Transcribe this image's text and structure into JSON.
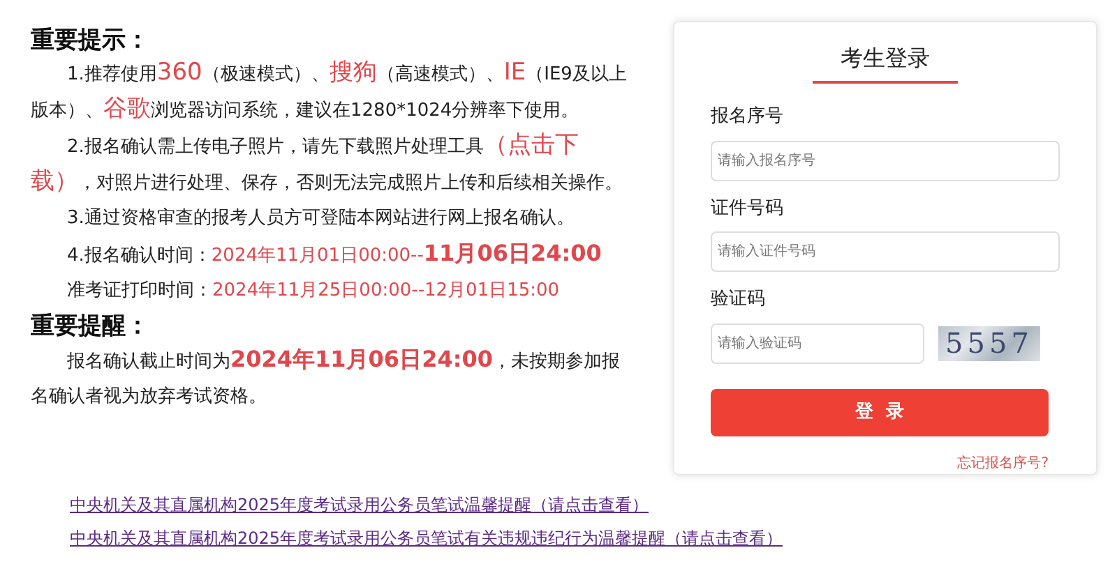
{
  "notice": {
    "heading": "重要提示：",
    "paragraphs": [
      [
        {
          "kind": "plain",
          "text": "1.推荐使用"
        },
        {
          "kind": "red-large",
          "text": "360"
        },
        {
          "kind": "plain",
          "text": "（极速模式）、"
        },
        {
          "kind": "red-large",
          "text": "搜狗"
        },
        {
          "kind": "plain",
          "text": "（高速模式）、"
        },
        {
          "kind": "red-large",
          "text": "IE"
        },
        {
          "kind": "plain",
          "text": "（IE9及以上版本）、"
        },
        {
          "kind": "red-large",
          "text": "谷歌"
        },
        {
          "kind": "plain",
          "text": "浏览器访问系统，建议在1280*1024分辨率下使用。"
        }
      ],
      [
        {
          "kind": "plain",
          "text": "2.报名确认需上传电子照片，请先下载照片处理工具"
        },
        {
          "kind": "red-large",
          "text": "（点击下载）"
        },
        {
          "kind": "plain",
          "text": "，对照片进行处理、保存，否则无法完成照片上传和后续相关操作。"
        }
      ],
      [
        {
          "kind": "plain",
          "text": "3.通过资格审查的报考人员方可登陆本网站进行网上报名确认。"
        }
      ],
      [
        {
          "kind": "plain",
          "text": "4.报名确认时间："
        },
        {
          "kind": "red",
          "text": "2024年11月01日00:00--"
        },
        {
          "kind": "red-bold",
          "text": "11月06日24:00"
        }
      ],
      [
        {
          "kind": "plain",
          "text": "准考证打印时间："
        },
        {
          "kind": "red",
          "text": "2024年11月25日00:00--12月01日15:00"
        }
      ]
    ]
  },
  "reminder": {
    "heading": "重要提醒：",
    "paragraphs": [
      [
        {
          "kind": "plain",
          "text": "报名确认截止时间为"
        },
        {
          "kind": "red-bold",
          "text": "2024年11月06日24:00"
        },
        {
          "kind": "plain",
          "text": "，未按期参加报名确认者视为放弃考试资格。"
        }
      ]
    ]
  },
  "links": [
    "中央机关及其直属机构2025年度考试录用公务员笔试温馨提醒（请点击查看）",
    "中央机关及其直属机构2025年度考试录用公务员笔试有关违规违纪行为温馨提醒（请点击查看）"
  ],
  "login": {
    "title": "考生登录",
    "fields": [
      {
        "kind": "text",
        "label": "报名序号",
        "placeholder": "请输入报名序号"
      },
      {
        "kind": "text",
        "label": "证件号码",
        "placeholder": "请输入证件号码"
      },
      {
        "kind": "captcha",
        "label": "验证码",
        "placeholder": "请输入验证码",
        "captcha": "5557"
      }
    ],
    "button": "登  录",
    "forgot": "忘记报名序号?"
  }
}
